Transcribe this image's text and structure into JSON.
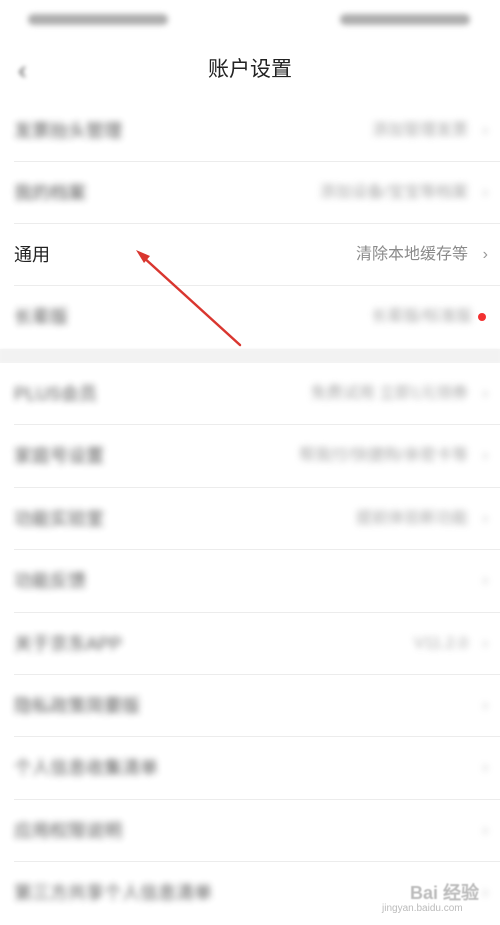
{
  "header": {
    "title": "账户设置",
    "back_icon": "chevron-left-icon"
  },
  "group1": [
    {
      "label": "发票抬头管理",
      "value": "添加管理发票",
      "blurred": true
    },
    {
      "label": "我的档案",
      "value": "添加设备/宝宝等档案",
      "blurred": true
    },
    {
      "label": "通用",
      "value": "清除本地缓存等",
      "blurred": false
    },
    {
      "label": "长辈版",
      "value": "长辈版/标准版",
      "blurred": true,
      "dot": true
    }
  ],
  "group2": [
    {
      "label": "PLUS会员",
      "value": "免费试用 立即1元领券",
      "blurred": true
    },
    {
      "label": "家庭号设置",
      "value": "帮我付/快捷购/亲密卡等",
      "blurred": true
    },
    {
      "label": "功能实验室",
      "value": "提前体验新功能",
      "blurred": true
    },
    {
      "label": "功能反馈",
      "value": "",
      "blurred": true
    },
    {
      "label": "关于京东APP",
      "value": "V11.2.0",
      "blurred": true
    },
    {
      "label": "隐私政策简要版",
      "value": "",
      "blurred": true
    },
    {
      "label": "个人信息收集清单",
      "value": "",
      "blurred": true
    },
    {
      "label": "应用权限说明",
      "value": "",
      "blurred": true
    },
    {
      "label": "第三方共享个人信息清单",
      "value": "",
      "blurred": true
    }
  ],
  "chevron": "›",
  "watermark": {
    "text": "Bai 经验",
    "sub": "jingyan.baidu.com"
  },
  "colors": {
    "arrow": "#d9362f",
    "dot": "#f23030"
  }
}
